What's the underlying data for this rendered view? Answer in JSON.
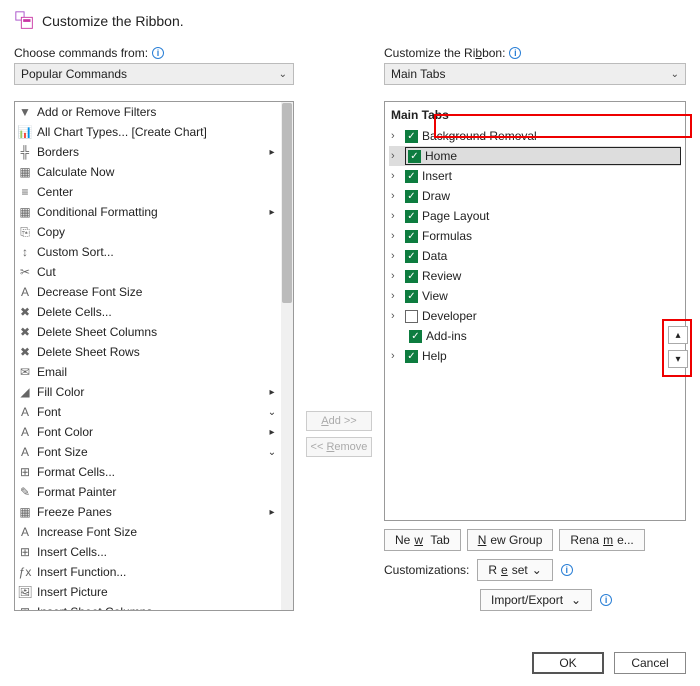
{
  "title": "Customize the Ribbon.",
  "left": {
    "label": "Choose commands from:",
    "combo": "Popular Commands",
    "items": [
      {
        "label": "Add or Remove Filters",
        "sub": ""
      },
      {
        "label": "All Chart Types... [Create Chart]",
        "sub": ""
      },
      {
        "label": "Borders",
        "sub": "▸"
      },
      {
        "label": "Calculate Now",
        "sub": ""
      },
      {
        "label": "Center",
        "sub": ""
      },
      {
        "label": "Conditional Formatting",
        "sub": "▸"
      },
      {
        "label": "Copy",
        "sub": ""
      },
      {
        "label": "Custom Sort...",
        "sub": ""
      },
      {
        "label": "Cut",
        "sub": ""
      },
      {
        "label": "Decrease Font Size",
        "sub": ""
      },
      {
        "label": "Delete Cells...",
        "sub": ""
      },
      {
        "label": "Delete Sheet Columns",
        "sub": ""
      },
      {
        "label": "Delete Sheet Rows",
        "sub": ""
      },
      {
        "label": "Email",
        "sub": ""
      },
      {
        "label": "Fill Color",
        "sub": "▸"
      },
      {
        "label": "Font",
        "sub": "⌄"
      },
      {
        "label": "Font Color",
        "sub": "▸"
      },
      {
        "label": "Font Size",
        "sub": "⌄"
      },
      {
        "label": "Format Cells...",
        "sub": ""
      },
      {
        "label": "Format Painter",
        "sub": ""
      },
      {
        "label": "Freeze Panes",
        "sub": "▸"
      },
      {
        "label": "Increase Font Size",
        "sub": ""
      },
      {
        "label": "Insert Cells...",
        "sub": ""
      },
      {
        "label": "Insert Function...",
        "sub": ""
      },
      {
        "label": "Insert Picture",
        "sub": ""
      },
      {
        "label": "Insert Sheet Columns",
        "sub": ""
      }
    ]
  },
  "mid": {
    "add": "Add >>",
    "remove": "<< Remove"
  },
  "right": {
    "label": "Customize the Ribbon:",
    "combo": "Main Tabs",
    "tree_title": "Main Tabs",
    "items": [
      {
        "label": "Background Removal",
        "checked": true,
        "selected": false
      },
      {
        "label": "Home",
        "checked": true,
        "selected": true
      },
      {
        "label": "Insert",
        "checked": true,
        "selected": false
      },
      {
        "label": "Draw",
        "checked": true,
        "selected": false
      },
      {
        "label": "Page Layout",
        "checked": true,
        "selected": false
      },
      {
        "label": "Formulas",
        "checked": true,
        "selected": false
      },
      {
        "label": "Data",
        "checked": true,
        "selected": false
      },
      {
        "label": "Review",
        "checked": true,
        "selected": false
      },
      {
        "label": "View",
        "checked": true,
        "selected": false
      },
      {
        "label": "Developer",
        "checked": false,
        "selected": false
      },
      {
        "label": "Add-ins",
        "checked": true,
        "selected": false,
        "indent": true
      },
      {
        "label": "Help",
        "checked": true,
        "selected": false
      }
    ],
    "new_tab": "New Tab",
    "new_group": "New Group",
    "rename": "Rename...",
    "customizations": "Customizations:",
    "reset": "Reset",
    "import_export": "Import/Export"
  },
  "bottom": {
    "ok": "OK",
    "cancel": "Cancel"
  }
}
